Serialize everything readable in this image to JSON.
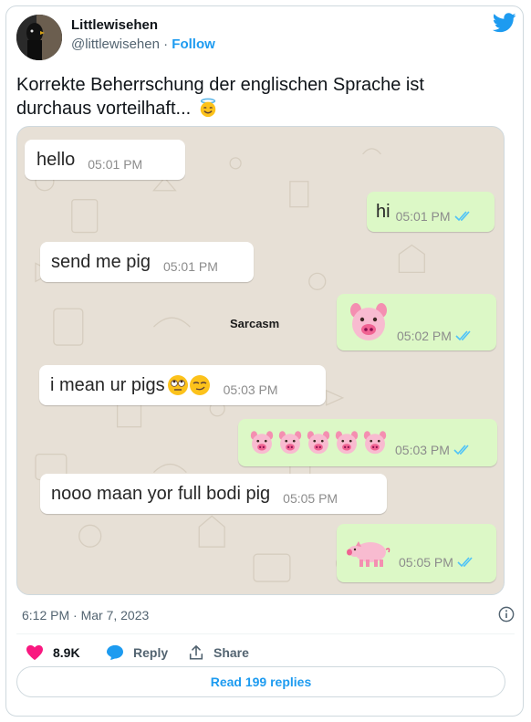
{
  "author": {
    "name": "Littlewisehen",
    "handle": "@littlewisehen",
    "separator": " · ",
    "follow_label": "Follow"
  },
  "tweet": {
    "text": "Korrekte Beherrschung der englischen Sprache ist durchaus vorteilhaft...",
    "emoji": "smiling-face-with-halo"
  },
  "chat": {
    "caption": "Sarcasm",
    "messages": [
      {
        "dir": "in",
        "text": "hello",
        "time": "05:01 PM"
      },
      {
        "dir": "out",
        "text": "hi",
        "time": "05:01 PM"
      },
      {
        "dir": "in",
        "text": "send me pig",
        "time": "05:01 PM"
      },
      {
        "dir": "out",
        "text": "",
        "emoji": "pig-face",
        "emoji_count": 1,
        "time": "05:02 PM"
      },
      {
        "dir": "in",
        "text": "i mean ur pigs",
        "emoji": "rolling-eyes-smirk",
        "time": "05:03 PM"
      },
      {
        "dir": "out",
        "text": "",
        "emoji": "pig-face",
        "emoji_count": 5,
        "time": "05:03 PM"
      },
      {
        "dir": "in",
        "text": "nooo maan yor full bodi pig",
        "time": "05:05 PM"
      },
      {
        "dir": "out",
        "text": "",
        "emoji": "pig",
        "emoji_count": 1,
        "time": "05:05 PM"
      }
    ]
  },
  "meta": {
    "timestamp": "6:12 PM · Mar 7, 2023"
  },
  "actions": {
    "like_count": "8.9K",
    "reply_label": "Reply",
    "share_label": "Share",
    "read_replies_label": "Read 199 replies"
  },
  "colors": {
    "twitter_blue": "#1d9bf0",
    "like_pink": "#f91880",
    "outgoing_bubble": "#dcf8c6",
    "read_ticks": "#4fc3f7"
  }
}
